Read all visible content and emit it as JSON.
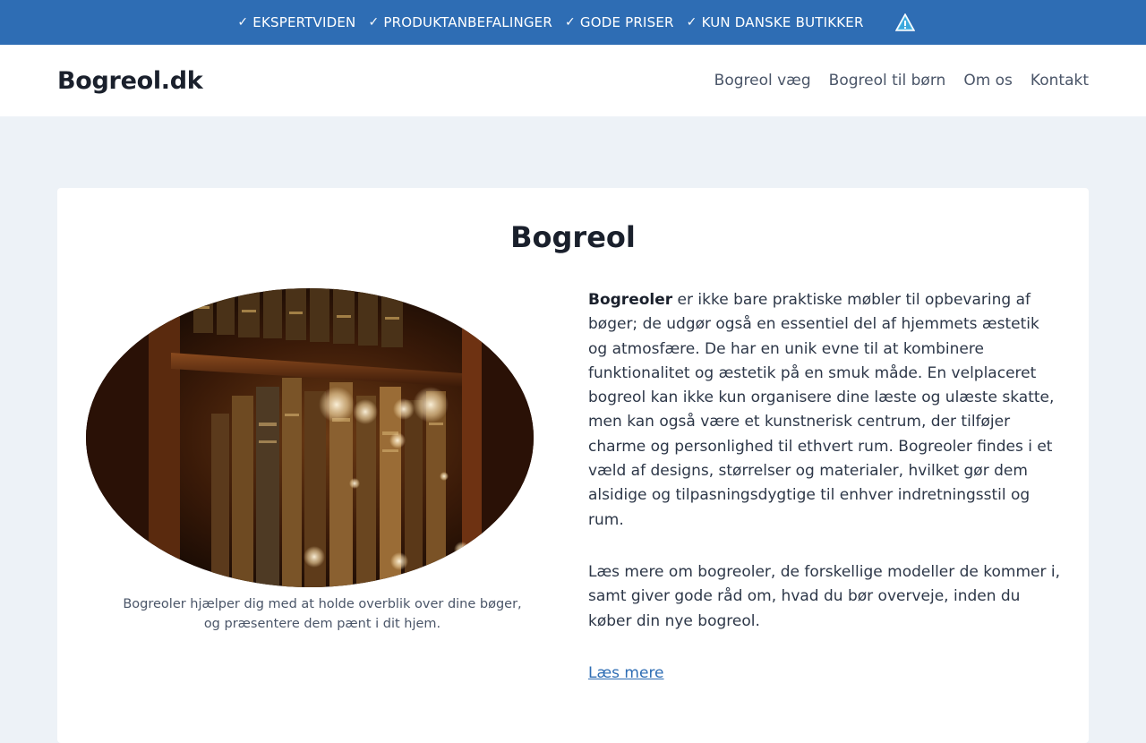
{
  "topbar": {
    "items": [
      "EKSPERTVIDEN",
      "PRODUKTANBEFALINGER",
      "GODE PRISER",
      "KUN DANSKE BUTIKKER"
    ],
    "check_glyph": "✓",
    "icon": "warning-info-icon",
    "bg_color": "#2e6db4"
  },
  "header": {
    "logo": "Bogreol.dk",
    "nav": [
      "Bogreol væg",
      "Bogreol til børn",
      "Om os",
      "Kontakt"
    ]
  },
  "main": {
    "title": "Bogreol",
    "figure": {
      "image": "bookshelf-photo",
      "caption": "Bogreoler hjælper dig med at holde overblik over dine bøger, og præsentere dem pænt i dit hjem."
    },
    "intro_bold": "Bogreoler",
    "intro_rest": " er ikke bare praktiske møbler til opbevaring af bøger; de udgør også en essentiel del af hjemmets æstetik og atmosfære. De har en unik evne til at kombinere funktionalitet og æstetik på en smuk måde. En velplaceret bogreol kan ikke kun organisere dine læste og ulæste skatte, men kan også være et kunstnerisk centrum, der tilføjer charme og personlighed til ethvert rum. Bogreoler findes i et væld af designs, størrelser og materialer, hvilket gør dem alsidige og tilpasningsdygtige til enhver indretningsstil og rum.",
    "paragraph2": "Læs mere om bogreoler, de forskellige modeller de kommer i, samt giver gode råd om, hvad du bør overveje, inden du køber din nye bogreol.",
    "read_more": "Læs mere",
    "link_color": "#2e6db4"
  }
}
